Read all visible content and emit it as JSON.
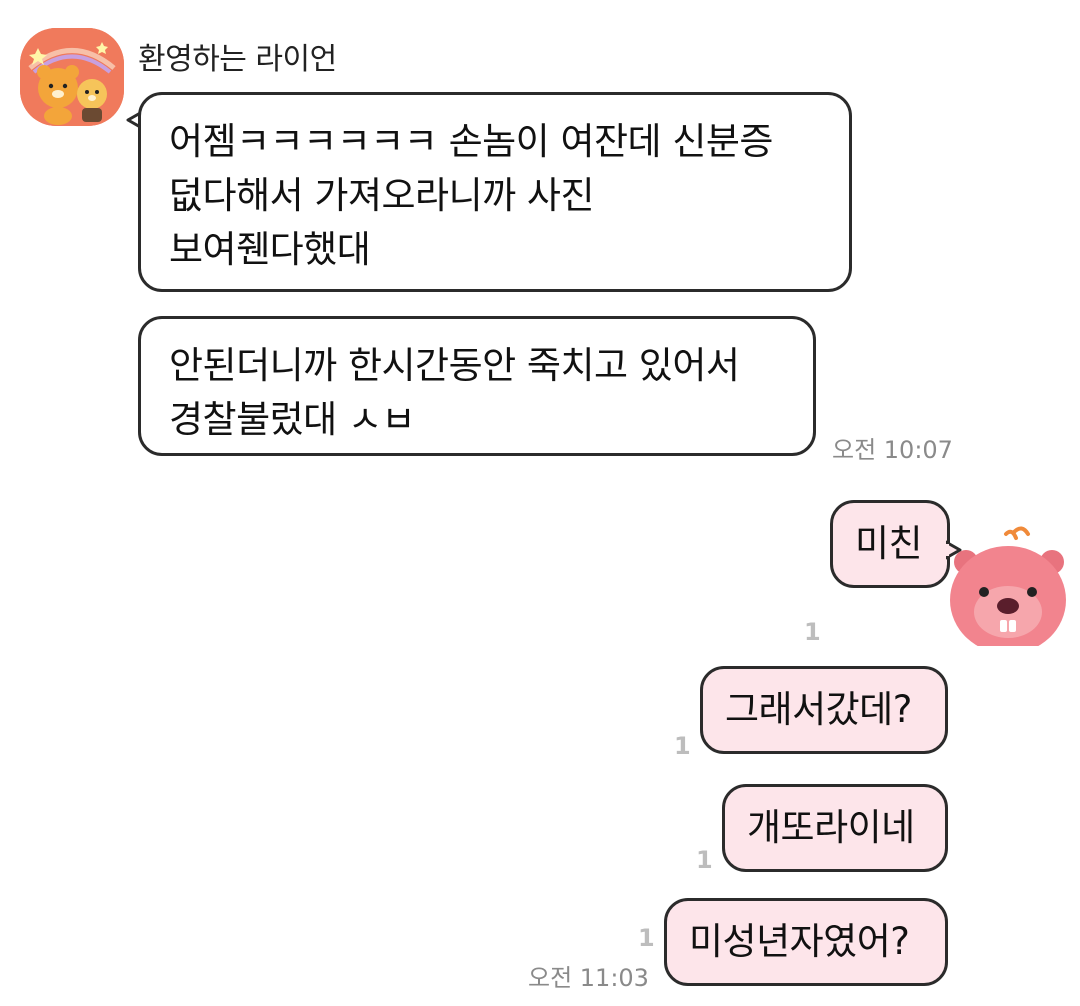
{
  "sender": {
    "name": "환영하는 라이언"
  },
  "incoming": [
    {
      "lines": [
        "어젬ㅋㅋㅋㅋㅋㅋ 손놈이 여잔데 신분증",
        "덦다해서 가져오라니까 사진",
        "보여줸다했대"
      ]
    },
    {
      "lines": [
        "안된더니까 한시간동안 죽치고 있어서",
        "경찰불렀대 ㅅㅂ"
      ],
      "time": "오전 10:07"
    }
  ],
  "outgoing": [
    {
      "text": "미친",
      "unread": "1"
    },
    {
      "text": "그래서갔데?",
      "unread": "1"
    },
    {
      "text": "개또라이네",
      "unread": "1"
    },
    {
      "text": "미성년자였어?",
      "unread": "1",
      "time": "오전 11:03"
    }
  ],
  "colors": {
    "incoming_bubble": "#ffffff",
    "outgoing_bubble": "#fde5ea",
    "avatar_bg": "#f07a5c",
    "bubble_border": "#2b2b2b"
  },
  "icons": {
    "avatar": "ryan-and-choonsik-avatar",
    "sticker": "loopy-beaver-sticker"
  }
}
